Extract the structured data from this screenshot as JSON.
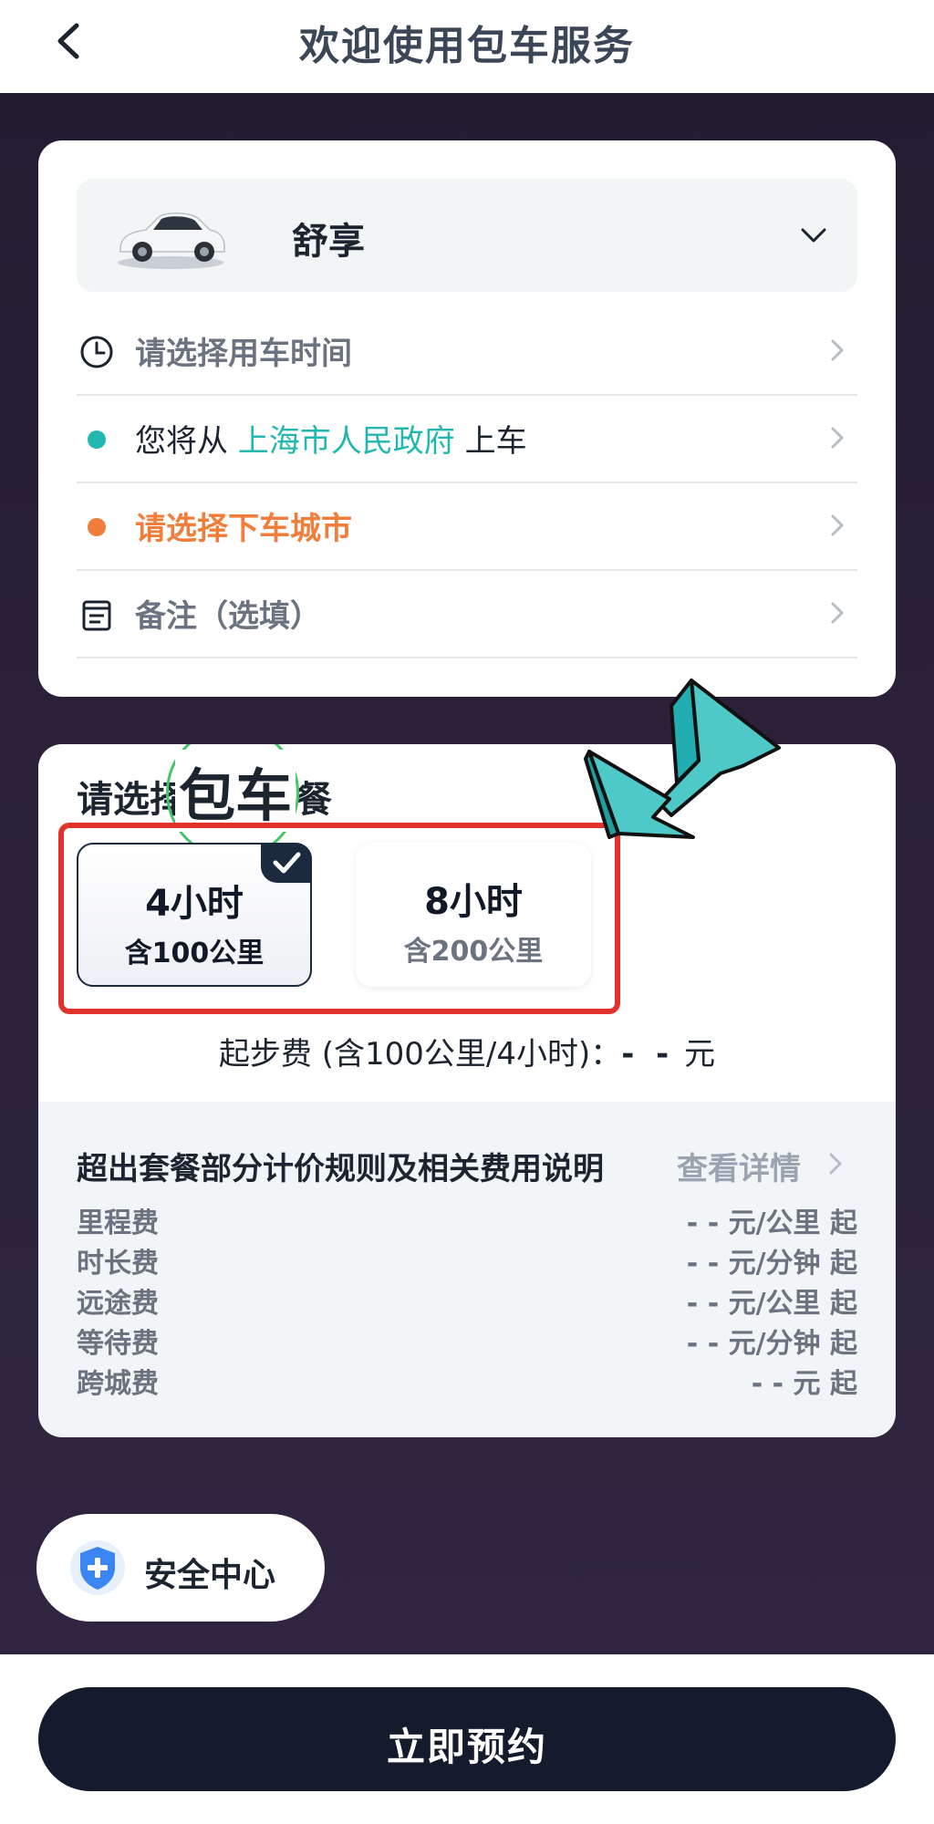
{
  "header": {
    "title": "欢迎使用包车服务"
  },
  "vehicle": {
    "name": "舒享"
  },
  "form": {
    "time_label": "请选择用车时间",
    "pickup_prefix": "您将从 ",
    "pickup_place": "上海市人民政府",
    "pickup_suffix": " 上车",
    "dropoff_label": "请选择下车城市",
    "remark_label": "备注（选填）"
  },
  "packages": {
    "title": "请选择包车套餐",
    "overlay_text": "包车",
    "items": [
      {
        "hours": "4小时",
        "km": "含100公里",
        "selected": true
      },
      {
        "hours": "8小时",
        "km": "含200公里",
        "selected": false
      }
    ],
    "start_fee": "起步费 (含100公里/4小时)：",
    "start_fee_value": "- -",
    "start_fee_unit": " 元"
  },
  "rules": {
    "title": "超出套餐部分计价规则及相关费用说明",
    "link": "查看详情",
    "fees": [
      {
        "name": "里程费",
        "value": "- - 元/公里 起"
      },
      {
        "name": "时长费",
        "value": "- - 元/分钟 起"
      },
      {
        "name": "远途费",
        "value": "- - 元/公里 起"
      },
      {
        "name": "等待费",
        "value": "- - 元/分钟 起"
      },
      {
        "name": "跨城费",
        "value": "- - 元 起"
      }
    ]
  },
  "safety": {
    "label": "安全中心"
  },
  "book": {
    "label": "立即预约"
  },
  "colors": {
    "accent_teal": "#22b8b0",
    "accent_orange": "#f07d3a",
    "highlight_red": "#e3312b",
    "dark_bg": "#231c31",
    "button_dark": "#141b2d"
  }
}
